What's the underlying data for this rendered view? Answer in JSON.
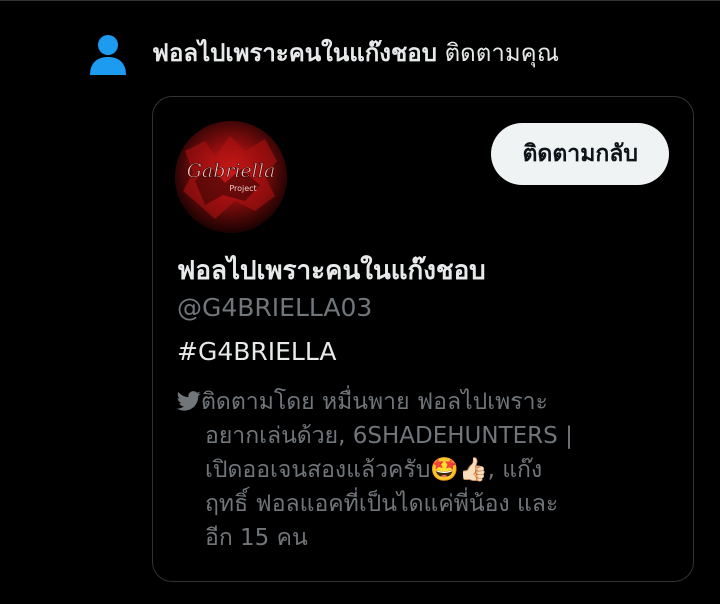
{
  "notification": {
    "display_name": "ฟอลไปเพราะคนในแก๊งชอบ",
    "action": " ติดตามคุณ",
    "icon": "person-icon",
    "icon_color": "#1d9bf0"
  },
  "profile_card": {
    "avatar_text": "Gabriella",
    "avatar_subtext": "Project",
    "follow_back_label": "ติดตามกลับ",
    "display_name": "ฟอลไปเพราะคนในแก๊งชอบ",
    "handle": "@G4BRIELLA03",
    "bio": "#G4BRIELLA",
    "followed_by": {
      "icon": "bird-icon",
      "lines": [
        "ติดตามโดย หมื่นพาย ฟอลไปเพราะ",
        "อยากเล่นด้วย, 6SHADEHUNTERS |",
        "เปิดออเจนสองแล้วครับ🤩👍🏻, แก๊ง",
        "ฤทธิ์ ฟอลแอคที่เป็นไดแค่พี่น้อง และ",
        "อีก 15 คน"
      ]
    }
  },
  "colors": {
    "background": "#000000",
    "text_primary": "#e7e9ea",
    "text_secondary": "#71767b",
    "border": "#2f3336",
    "button_bg": "#eff3f4"
  }
}
